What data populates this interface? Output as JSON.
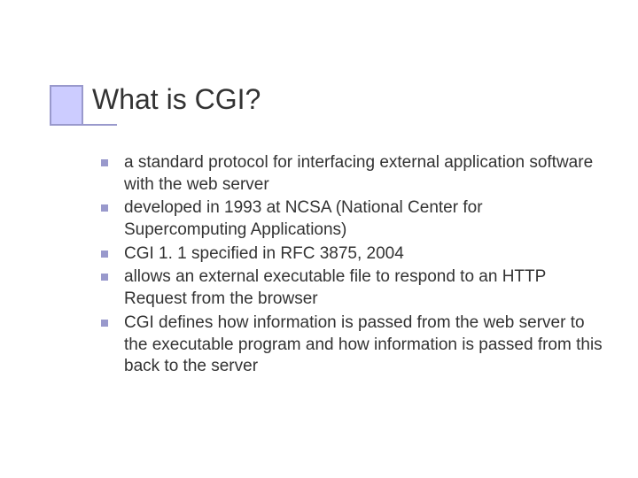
{
  "slide": {
    "title": "What is CGI?",
    "bullets": [
      "a standard protocol for interfacing external application software with the web server",
      "developed in 1993 at NCSA (National Center for Supercomputing Applications)",
      "CGI 1. 1 specified in RFC 3875, 2004",
      "allows an external executable file to respond to an HTTP Request from the browser",
      "CGI defines how information is passed from the web server to the executable program and how information is passed from this back to the server"
    ]
  }
}
